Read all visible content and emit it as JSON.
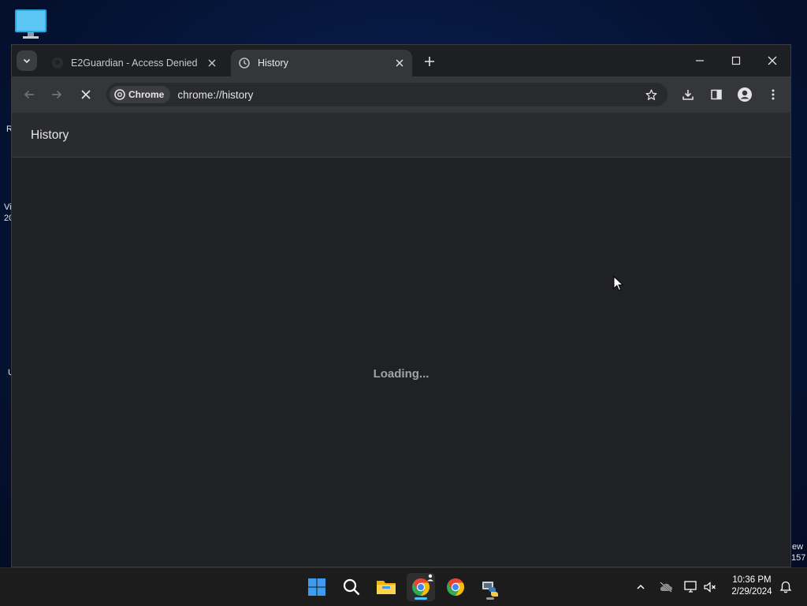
{
  "browser": {
    "tabs": [
      {
        "title": "E2Guardian - Access Denied",
        "active": false
      },
      {
        "title": "History",
        "active": true
      }
    ],
    "chip_label": "Chrome",
    "url": "chrome://history"
  },
  "page": {
    "title": "History",
    "loading_text": "Loading..."
  },
  "desktop": {
    "left_fragments": [
      "R",
      "Vi",
      "20",
      "U"
    ],
    "right_fragments": [
      "ew",
      "157"
    ]
  },
  "taskbar": {
    "apps": [
      "windows-start",
      "search",
      "file-explorer",
      "chrome",
      "chrome",
      "python-app"
    ],
    "clock": {
      "time": "10:36 PM",
      "date": "2/29/2024"
    }
  },
  "colors": {
    "chrome_red": "#ea4335",
    "chrome_green": "#34a853",
    "chrome_yellow": "#fbbc04",
    "chrome_blue": "#4285f4",
    "windows_blue": "#3d9bf0"
  }
}
